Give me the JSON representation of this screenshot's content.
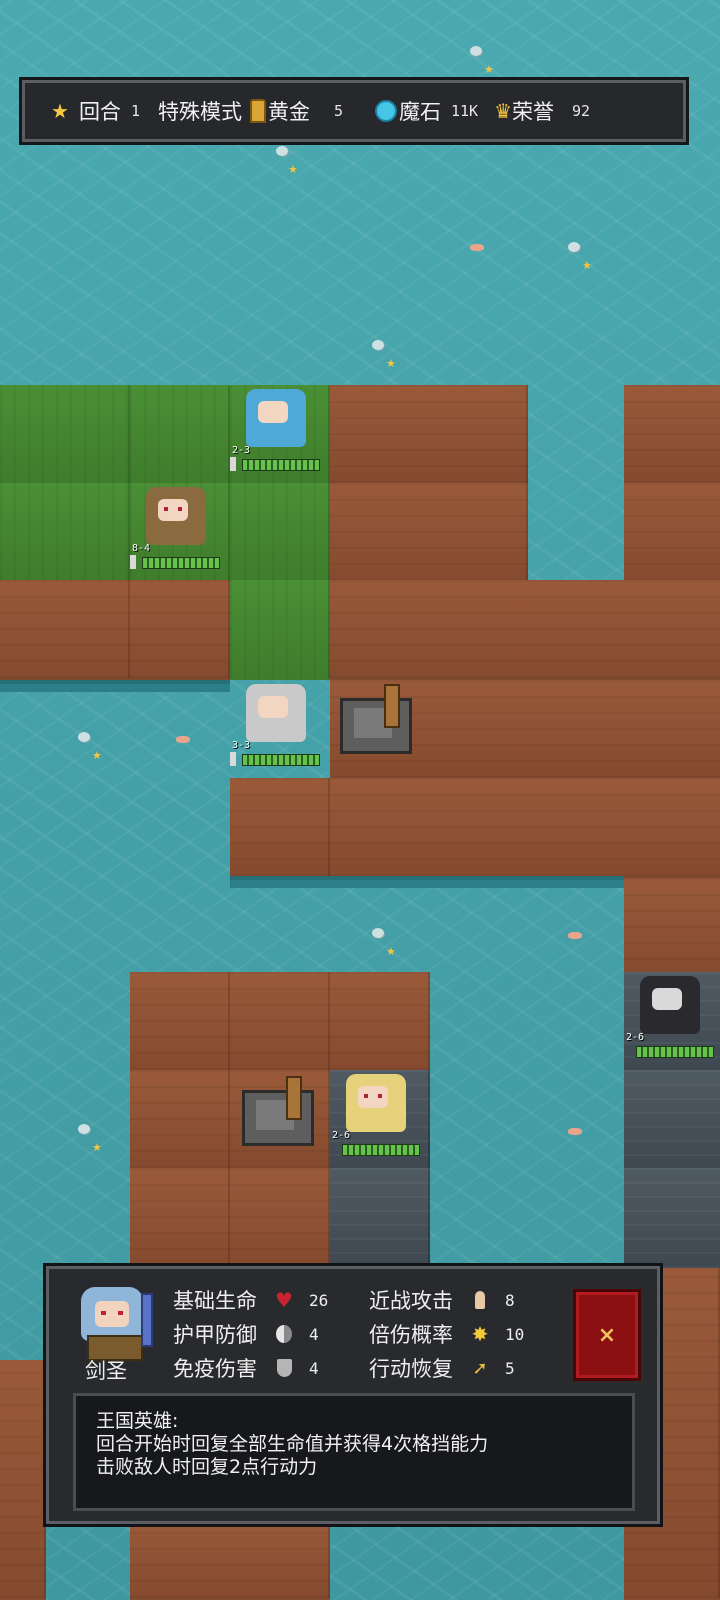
{
  "topbar": {
    "round_label": "回合",
    "round_value": "1",
    "mode_label": "特殊模式",
    "gold_label": "黄金",
    "gold_value": "5",
    "mana_label": "魔石",
    "mana_value": "11K",
    "honor_label": "荣誉",
    "honor_value": "92"
  },
  "units": [
    {
      "level": "2-3"
    },
    {
      "level": "8-4"
    },
    {
      "level": "3-3"
    },
    {
      "level": "2-6"
    },
    {
      "level": "2-6"
    }
  ],
  "hero_panel": {
    "name": "剑圣",
    "stats": {
      "base_hp_label": "基础生命",
      "base_hp_value": "26",
      "melee_label": "近战攻击",
      "melee_value": "8",
      "armor_label": "护甲防御",
      "armor_value": "4",
      "crit_label": "倍伤概率",
      "crit_value": "10",
      "immune_label": "免疫伤害",
      "immune_value": "4",
      "move_label": "行动恢复",
      "move_value": "5"
    },
    "close_label": "×",
    "description": {
      "title": "王国英雄:",
      "line1": "回合开始时回复全部生命值并获得4次格挡能力",
      "line2": "击败敌人时回复2点行动力"
    }
  },
  "colors": {
    "water": "#49a6ad",
    "grass": "#4a8f35",
    "dirt": "#9a5a3a",
    "stone": "#4f5a63",
    "panel": "#282a2e",
    "close_red": "#8c0f12",
    "gold": "#f4c542"
  },
  "icons": {
    "round": "star-icon",
    "gold": "gold-bar-icon",
    "mana": "mana-stone-icon",
    "honor": "crown-icon",
    "hp": "heart-icon",
    "armor": "armor-icon",
    "immune": "shield-icon",
    "melee": "fist-icon",
    "crit": "burst-icon",
    "move": "boot-icon"
  }
}
